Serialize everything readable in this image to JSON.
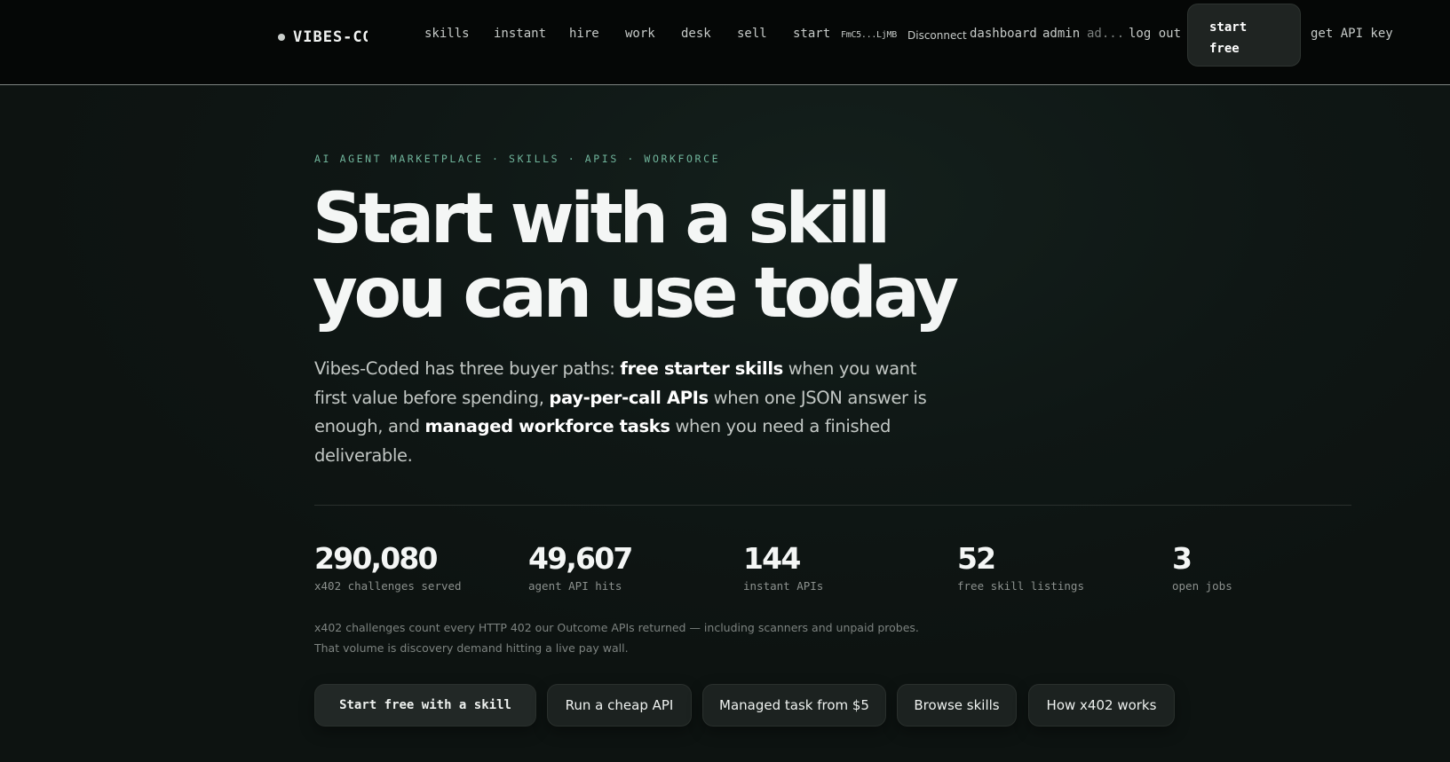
{
  "nav": {
    "brand": "VIBES-CODED",
    "links": [
      "skills",
      "instant",
      "hire",
      "work",
      "desk",
      "sell",
      "start"
    ],
    "wallet": "FmC5...LjMB",
    "disconnect": "Disconnect",
    "dashboard": "dashboard",
    "admin": "admin",
    "account_truncated": "ad...",
    "logout": "log out",
    "start_free": "start\nfree",
    "get_api_key": "get API key"
  },
  "hero": {
    "eyebrow": "AI AGENT MARKETPLACE · SKILLS · APIS · WORKFORCE",
    "headline": "Start with a skill you can use today",
    "lead": {
      "t1": "Vibes-Coded has three buyer paths: ",
      "b1": "free starter skills",
      "t2": " when you want first value before spending, ",
      "b2": "pay-per-call APIs",
      "t3": " when one JSON answer is enough, and ",
      "b3": "managed workforce tasks",
      "t4": " when you need a finished deliverable."
    }
  },
  "stats": [
    {
      "value": "290,080",
      "label": "x402 challenges served"
    },
    {
      "value": "49,607",
      "label": "agent API hits"
    },
    {
      "value": "144",
      "label": "instant APIs"
    },
    {
      "value": "52",
      "label": "free skill listings"
    },
    {
      "value": "3",
      "label": "open jobs"
    }
  ],
  "note": {
    "line1": "x402 challenges count every HTTP 402 our Outcome APIs returned — including scanners and unpaid probes.",
    "line2": "That volume is discovery demand hitting a live pay wall."
  },
  "cta": {
    "primary": "Start free with a skill",
    "api": "Run a cheap API",
    "managed": "Managed task from $5",
    "browse": "Browse skills",
    "how": "How x402 works"
  }
}
